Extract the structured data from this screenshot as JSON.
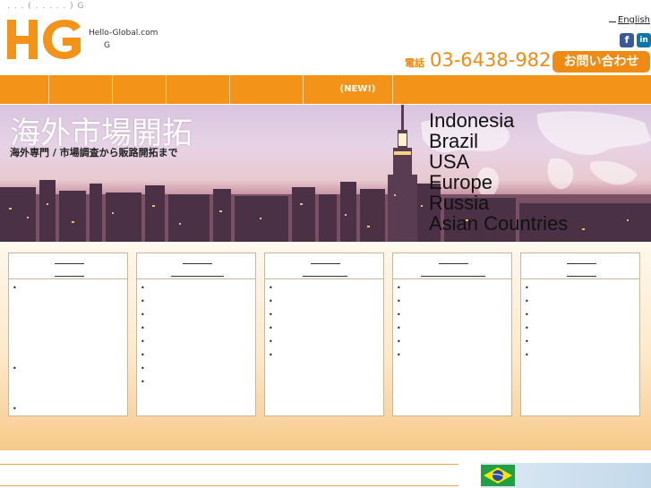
{
  "header": {
    "top_note": ". . . ( . . . . . ) G",
    "brand_name": "Hello-Global.com",
    "brand_sub": "G",
    "language_link": "English",
    "phone_label": "電話",
    "phone_number": "03-6438-9821",
    "contact_button": "お問い合わせ",
    "social": {
      "facebook": "f",
      "linkedin": "in"
    }
  },
  "nav": {
    "items": [
      {
        "label": ""
      },
      {
        "label": ""
      },
      {
        "label": ""
      },
      {
        "label": ""
      },
      {
        "label": ""
      },
      {
        "label": ""
      },
      {
        "label": "(NEW!)"
      },
      {
        "label": ""
      }
    ]
  },
  "hero": {
    "title": "海外市場開拓",
    "subtitle": "海外専門 / 市場調査から販路開拓まで",
    "countries": [
      "Indonesia",
      "Brazil",
      "USA",
      "Europe",
      "Russia",
      "Asian Countries"
    ]
  },
  "panels": [
    {
      "bullets": 3
    },
    {
      "bullets": 8
    },
    {
      "bullets": 6
    },
    {
      "bullets": 6
    },
    {
      "bullets": 6
    }
  ],
  "colors": {
    "brand_orange": "#f39419",
    "accent_orange": "#ef8a12",
    "facebook": "#3b5998",
    "linkedin": "#0e76a8"
  },
  "icons": [
    "logo-hg",
    "facebook-icon",
    "linkedin-icon",
    "brazil-flag-icon"
  ]
}
